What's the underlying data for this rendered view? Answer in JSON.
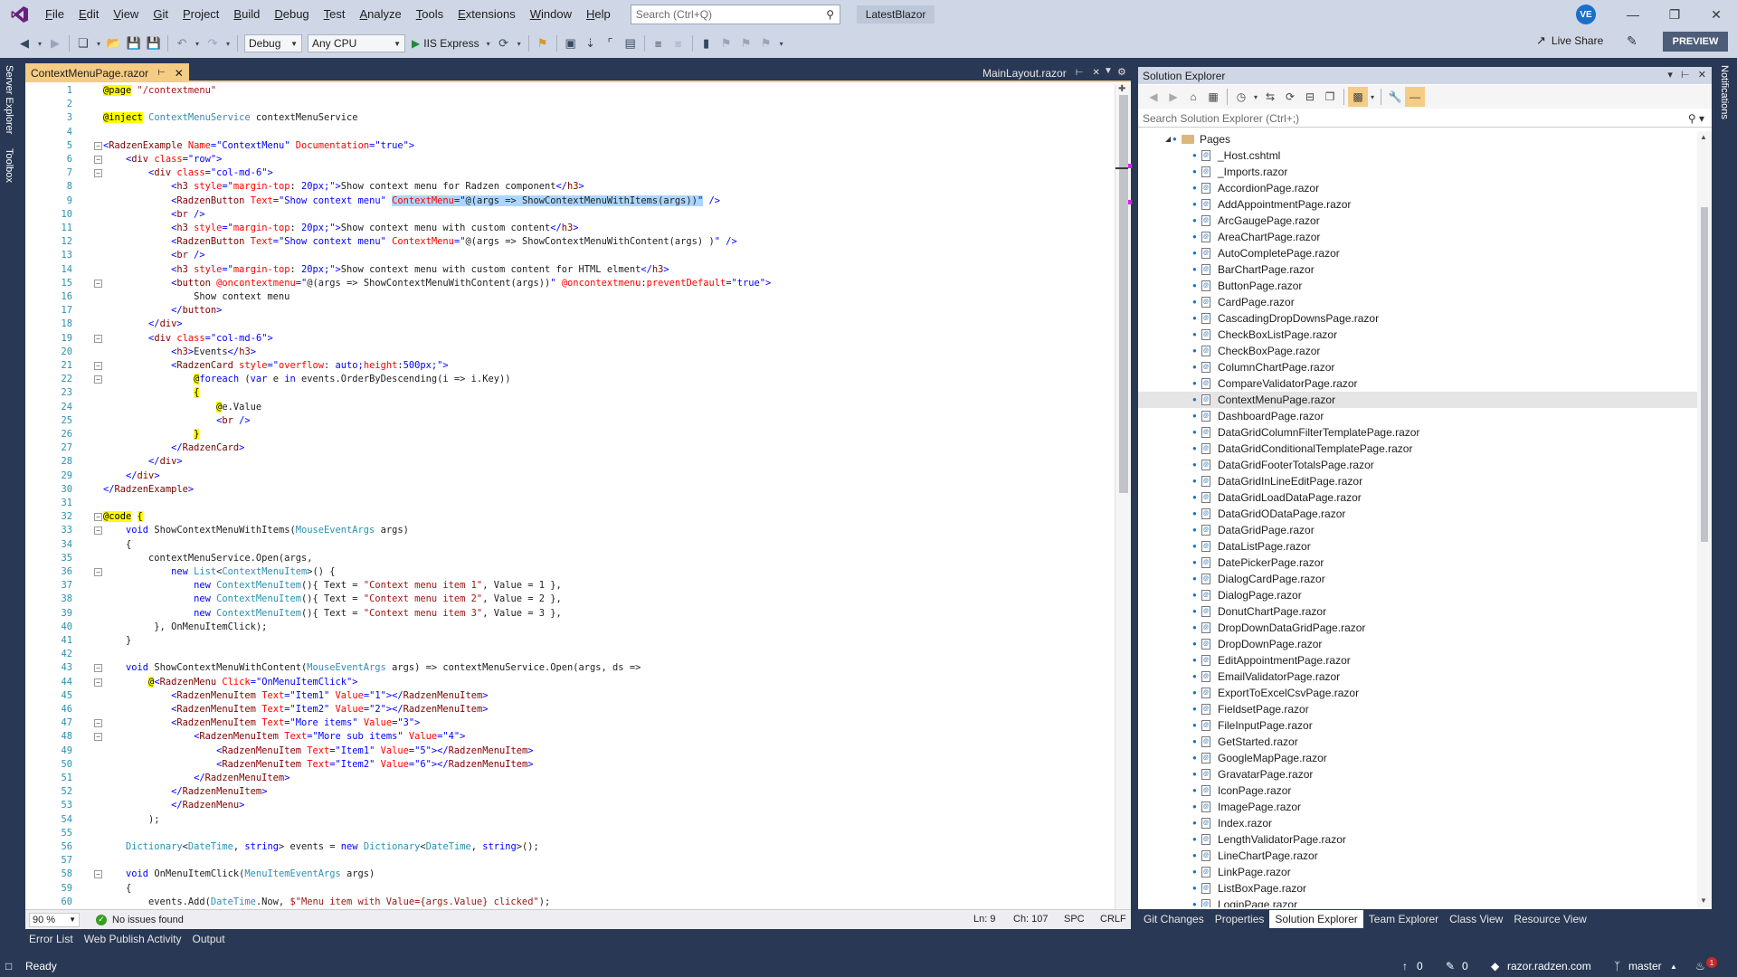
{
  "menu": [
    "File",
    "Edit",
    "View",
    "Git",
    "Project",
    "Build",
    "Debug",
    "Test",
    "Analyze",
    "Tools",
    "Extensions",
    "Window",
    "Help"
  ],
  "search_placeholder": "Search (Ctrl+Q)",
  "solution_name": "LatestBlazor",
  "user_initials": "VE",
  "toolbar": {
    "config": "Debug",
    "platform": "Any CPU",
    "run_label": "IIS Express",
    "live_share": "Live Share",
    "preview": "PREVIEW"
  },
  "left_rail": [
    "Server Explorer",
    "Toolbox"
  ],
  "right_rail": [
    "Notifications"
  ],
  "tabs": {
    "active": "ContextMenuPage.razor",
    "inactive": "MainLayout.razor"
  },
  "code_lines": [
    {
      "n": "1",
      "html": "<span class=\"dir\">@page</span> <span class=\"str\">\"/contextmenu\"</span>"
    },
    {
      "n": "2",
      "html": ""
    },
    {
      "n": "3",
      "html": "<span class=\"dir\">@inject</span> <span class=\"type\">ContextMenuService</span> contextMenuService"
    },
    {
      "n": "4",
      "html": ""
    },
    {
      "n": "5",
      "html": "<span class=\"kw\">&lt;</span><span class=\"tag\">RadzenExample</span> <span class=\"attr\">Name</span><span class=\"kw\">=\"ContextMenu\"</span> <span class=\"attr\">Documentation</span><span class=\"kw\">=\"true\"&gt;</span>"
    },
    {
      "n": "6",
      "html": "    <span class=\"kw\">&lt;</span><span class=\"tag\">div</span> <span class=\"attr\">class</span><span class=\"kw\">=\"row\"&gt;</span>"
    },
    {
      "n": "7",
      "html": "        <span class=\"kw\">&lt;</span><span class=\"tag\">div</span> <span class=\"attr\">class</span><span class=\"kw\">=\"col-md-6\"&gt;</span>"
    },
    {
      "n": "8",
      "html": "            <span class=\"kw\">&lt;</span><span class=\"tag\">h3</span> <span class=\"attr\">style</span><span class=\"kw\">=\"</span><span class=\"attr\">margin-top</span>: <span class=\"kw\">20px;\"&gt;</span>Show context menu for Radzen component<span class=\"kw\">&lt;/</span><span class=\"tag\">h3</span><span class=\"kw\">&gt;</span>"
    },
    {
      "n": "9",
      "html": "            <span class=\"kw\">&lt;</span><span class=\"tag\">RadzenButton</span> <span class=\"attr\">Text</span><span class=\"kw\">=\"Show context menu\"</span> <span class=\"hl\"><span class=\"attr\">ContextMenu</span><span class=\"kw\">=\"</span>@(args =&gt; ShowContextMenuWithItems(args))<span class=\"kw\">\"</span></span> <span class=\"kw\">/&gt;</span>"
    },
    {
      "n": "10",
      "html": "            <span class=\"kw\">&lt;</span><span class=\"tag\">br</span> <span class=\"kw\">/&gt;</span>"
    },
    {
      "n": "11",
      "html": "            <span class=\"kw\">&lt;</span><span class=\"tag\">h3</span> <span class=\"attr\">style</span><span class=\"kw\">=\"</span><span class=\"attr\">margin-top</span>: <span class=\"kw\">20px;\"&gt;</span>Show context menu with custom content<span class=\"kw\">&lt;/</span><span class=\"tag\">h3</span><span class=\"kw\">&gt;</span>"
    },
    {
      "n": "12",
      "html": "            <span class=\"kw\">&lt;</span><span class=\"tag\">RadzenButton</span> <span class=\"attr\">Text</span><span class=\"kw\">=\"Show context menu\"</span> <span class=\"attr\">ContextMenu</span><span class=\"kw\">=\"</span>@(args =&gt; ShowContextMenuWithContent(args) )<span class=\"kw\">\"</span> <span class=\"kw\">/&gt;</span>"
    },
    {
      "n": "13",
      "html": "            <span class=\"kw\">&lt;</span><span class=\"tag\">br</span> <span class=\"kw\">/&gt;</span>"
    },
    {
      "n": "14",
      "html": "            <span class=\"kw\">&lt;</span><span class=\"tag\">h3</span> <span class=\"attr\">style</span><span class=\"kw\">=\"</span><span class=\"attr\">margin-top</span>: <span class=\"kw\">20px;\"&gt;</span>Show context menu with custom content for HTML elment<span class=\"kw\">&lt;/</span><span class=\"tag\">h3</span><span class=\"kw\">&gt;</span>"
    },
    {
      "n": "15",
      "html": "            <span class=\"kw\">&lt;</span><span class=\"tag\">button</span> <span class=\"attr\">@oncontextmenu</span><span class=\"kw\">=\"</span>@(args =&gt; ShowContextMenuWithContent(args))<span class=\"kw\">\"</span> <span class=\"attr\">@oncontextmenu</span>:<span class=\"attr\">preventDefault</span><span class=\"kw\">=\"true\"&gt;</span>"
    },
    {
      "n": "16",
      "html": "                Show context menu"
    },
    {
      "n": "17",
      "html": "            <span class=\"kw\">&lt;/</span><span class=\"tag\">button</span><span class=\"kw\">&gt;</span>"
    },
    {
      "n": "18",
      "html": "        <span class=\"kw\">&lt;/</span><span class=\"tag\">div</span><span class=\"kw\">&gt;</span>"
    },
    {
      "n": "19",
      "html": "        <span class=\"kw\">&lt;</span><span class=\"tag\">div</span> <span class=\"attr\">class</span><span class=\"kw\">=\"col-md-6\"&gt;</span>"
    },
    {
      "n": "20",
      "html": "            <span class=\"kw\">&lt;</span><span class=\"tag\">h3</span><span class=\"kw\">&gt;</span>Events<span class=\"kw\">&lt;/</span><span class=\"tag\">h3</span><span class=\"kw\">&gt;</span>"
    },
    {
      "n": "21",
      "html": "            <span class=\"kw\">&lt;</span><span class=\"tag\">RadzenCard</span> <span class=\"attr\">style</span><span class=\"kw\">=\"</span><span class=\"attr\">overflow</span>: <span class=\"kw\">auto;</span><span class=\"attr\">height</span>:<span class=\"kw\">500px;\"&gt;</span>"
    },
    {
      "n": "22",
      "html": "                <span class=\"dir\">@</span><span class=\"kw\">foreach</span> (<span class=\"kw\">var</span> e <span class=\"kw\">in</span> events.OrderByDescending(i =&gt; i.Key))"
    },
    {
      "n": "23",
      "html": "                <span class=\"dir\">{</span>"
    },
    {
      "n": "24",
      "html": "                    <span class=\"dir\">@</span>e.Value"
    },
    {
      "n": "25",
      "html": "                    <span class=\"kw\">&lt;</span><span class=\"tag\">br</span> <span class=\"kw\">/&gt;</span>"
    },
    {
      "n": "26",
      "html": "                <span class=\"dir\">}</span>"
    },
    {
      "n": "27",
      "html": "            <span class=\"kw\">&lt;/</span><span class=\"tag\">RadzenCard</span><span class=\"kw\">&gt;</span>"
    },
    {
      "n": "28",
      "html": "        <span class=\"kw\">&lt;/</span><span class=\"tag\">div</span><span class=\"kw\">&gt;</span>"
    },
    {
      "n": "29",
      "html": "    <span class=\"kw\">&lt;/</span><span class=\"tag\">div</span><span class=\"kw\">&gt;</span>"
    },
    {
      "n": "30",
      "html": "<span class=\"kw\">&lt;/</span><span class=\"tag\">RadzenExample</span><span class=\"kw\">&gt;</span>"
    },
    {
      "n": "31",
      "html": ""
    },
    {
      "n": "32",
      "html": "<span class=\"dir\">@code</span> <span class=\"dir\">{</span>"
    },
    {
      "n": "33",
      "html": "    <span class=\"kw\">void</span> ShowContextMenuWithItems(<span class=\"type\">MouseEventArgs</span> args)"
    },
    {
      "n": "34",
      "html": "    {"
    },
    {
      "n": "35",
      "html": "        contextMenuService.Open(args,"
    },
    {
      "n": "36",
      "html": "            <span class=\"kw\">new</span> <span class=\"type\">List</span>&lt;<span class=\"type\">ContextMenuItem</span>&gt;() {"
    },
    {
      "n": "37",
      "html": "                <span class=\"kw\">new</span> <span class=\"type\">ContextMenuItem</span>(){ Text = <span class=\"str\">\"Context menu item 1\"</span>, Value = 1 },"
    },
    {
      "n": "38",
      "html": "                <span class=\"kw\">new</span> <span class=\"type\">ContextMenuItem</span>(){ Text = <span class=\"str\">\"Context menu item 2\"</span>, Value = 2 },"
    },
    {
      "n": "39",
      "html": "                <span class=\"kw\">new</span> <span class=\"type\">ContextMenuItem</span>(){ Text = <span class=\"str\">\"Context menu item 3\"</span>, Value = 3 },"
    },
    {
      "n": "40",
      "html": "         }, OnMenuItemClick);"
    },
    {
      "n": "41",
      "html": "    }"
    },
    {
      "n": "42",
      "html": ""
    },
    {
      "n": "43",
      "html": "    <span class=\"kw\">void</span> ShowContextMenuWithContent(<span class=\"type\">MouseEventArgs</span> args) =&gt; contextMenuService.Open(args, ds =&gt;"
    },
    {
      "n": "44",
      "html": "        <span class=\"dir\">@</span><span class=\"kw\">&lt;</span><span class=\"tag\">RadzenMenu</span> <span class=\"attr\">Click</span><span class=\"kw\">=\"OnMenuItemClick\"&gt;</span>"
    },
    {
      "n": "45",
      "html": "            <span class=\"kw\">&lt;</span><span class=\"tag\">RadzenMenuItem</span> <span class=\"attr\">Text</span><span class=\"kw\">=\"Item1\"</span> <span class=\"attr\">Value</span><span class=\"kw\">=\"1\"&gt;&lt;/</span><span class=\"tag\">RadzenMenuItem</span><span class=\"kw\">&gt;</span>"
    },
    {
      "n": "46",
      "html": "            <span class=\"kw\">&lt;</span><span class=\"tag\">RadzenMenuItem</span> <span class=\"attr\">Text</span><span class=\"kw\">=\"Item2\"</span> <span class=\"attr\">Value</span><span class=\"kw\">=\"2\"&gt;&lt;/</span><span class=\"tag\">RadzenMenuItem</span><span class=\"kw\">&gt;</span>"
    },
    {
      "n": "47",
      "html": "            <span class=\"kw\">&lt;</span><span class=\"tag\">RadzenMenuItem</span> <span class=\"attr\">Text</span><span class=\"kw\">=\"More items\"</span> <span class=\"attr\">Value</span><span class=\"kw\">=\"3\"&gt;</span>"
    },
    {
      "n": "48",
      "html": "                <span class=\"kw\">&lt;</span><span class=\"tag\">RadzenMenuItem</span> <span class=\"attr\">Text</span><span class=\"kw\">=\"More sub items\"</span> <span class=\"attr\">Value</span><span class=\"kw\">=\"4\"&gt;</span>"
    },
    {
      "n": "49",
      "html": "                    <span class=\"kw\">&lt;</span><span class=\"tag\">RadzenMenuItem</span> <span class=\"attr\">Text</span><span class=\"kw\">=\"Item1\"</span> <span class=\"attr\">Value</span><span class=\"kw\">=\"5\"&gt;&lt;/</span><span class=\"tag\">RadzenMenuItem</span><span class=\"kw\">&gt;</span>"
    },
    {
      "n": "50",
      "html": "                    <span class=\"kw\">&lt;</span><span class=\"tag\">RadzenMenuItem</span> <span class=\"attr\">Text</span><span class=\"kw\">=\"Item2\"</span> <span class=\"attr\">Value</span><span class=\"kw\">=\"6\"&gt;&lt;/</span><span class=\"tag\">RadzenMenuItem</span><span class=\"kw\">&gt;</span>"
    },
    {
      "n": "51",
      "html": "                <span class=\"kw\">&lt;/</span><span class=\"tag\">RadzenMenuItem</span><span class=\"kw\">&gt;</span>"
    },
    {
      "n": "52",
      "html": "            <span class=\"kw\">&lt;/</span><span class=\"tag\">RadzenMenuItem</span><span class=\"kw\">&gt;</span>"
    },
    {
      "n": "53",
      "html": "            <span class=\"kw\">&lt;/</span><span class=\"tag\">RadzenMenu</span><span class=\"kw\">&gt;</span>"
    },
    {
      "n": "54",
      "html": "        );"
    },
    {
      "n": "55",
      "html": ""
    },
    {
      "n": "56",
      "html": "    <span class=\"type\">Dictionary</span>&lt;<span class=\"type\">DateTime</span>, <span class=\"kw\">string</span>&gt; events = <span class=\"kw\">new</span> <span class=\"type\">Dictionary</span>&lt;<span class=\"type\">DateTime</span>, <span class=\"kw\">string</span>&gt;();"
    },
    {
      "n": "57",
      "html": ""
    },
    {
      "n": "58",
      "html": "    <span class=\"kw\">void</span> OnMenuItemClick(<span class=\"type\">MenuItemEventArgs</span> args)"
    },
    {
      "n": "59",
      "html": "    {"
    },
    {
      "n": "60",
      "html": "        events.Add(<span class=\"type\">DateTime</span>.Now, <span class=\"str\">$\"Menu item with Value={args.Value} clicked\"</span>);"
    }
  ],
  "editor_status": {
    "zoom": "90 %",
    "issues": "No issues found",
    "line": "Ln: 9",
    "col": "Ch: 107",
    "spc": "SPC",
    "eol": "CRLF"
  },
  "solution_explorer": {
    "title": "Solution Explorer",
    "search_placeholder": "Search Solution Explorer (Ctrl+;)",
    "folder": "Pages",
    "selected": "ContextMenuPage.razor",
    "files": [
      "_Host.cshtml",
      "_Imports.razor",
      "AccordionPage.razor",
      "AddAppointmentPage.razor",
      "ArcGaugePage.razor",
      "AreaChartPage.razor",
      "AutoCompletePage.razor",
      "BarChartPage.razor",
      "ButtonPage.razor",
      "CardPage.razor",
      "CascadingDropDownsPage.razor",
      "CheckBoxListPage.razor",
      "CheckBoxPage.razor",
      "ColumnChartPage.razor",
      "CompareValidatorPage.razor",
      "ContextMenuPage.razor",
      "DashboardPage.razor",
      "DataGridColumnFilterTemplatePage.razor",
      "DataGridConditionalTemplatePage.razor",
      "DataGridFooterTotalsPage.razor",
      "DataGridInLineEditPage.razor",
      "DataGridLoadDataPage.razor",
      "DataGridODataPage.razor",
      "DataGridPage.razor",
      "DataListPage.razor",
      "DatePickerPage.razor",
      "DialogCardPage.razor",
      "DialogPage.razor",
      "DonutChartPage.razor",
      "DropDownDataGridPage.razor",
      "DropDownPage.razor",
      "EditAppointmentPage.razor",
      "EmailValidatorPage.razor",
      "ExportToExcelCsvPage.razor",
      "FieldsetPage.razor",
      "FileInputPage.razor",
      "GetStarted.razor",
      "GoogleMapPage.razor",
      "GravatarPage.razor",
      "IconPage.razor",
      "ImagePage.razor",
      "Index.razor",
      "LengthValidatorPage.razor",
      "LineChartPage.razor",
      "LinkPage.razor",
      "ListBoxPage.razor",
      "LoginPage.razor"
    ],
    "tabs": [
      "Git Changes",
      "Properties",
      "Solution Explorer",
      "Team Explorer",
      "Class View",
      "Resource View"
    ],
    "active_tab": "Solution Explorer"
  },
  "bottom_tabs": [
    "Error List",
    "Web Publish Activity",
    "Output"
  ],
  "status": {
    "ready": "Ready",
    "up_count": "0",
    "pencil_count": "0",
    "repo": "razor.radzen.com",
    "branch": "master",
    "notif_count": "1"
  }
}
